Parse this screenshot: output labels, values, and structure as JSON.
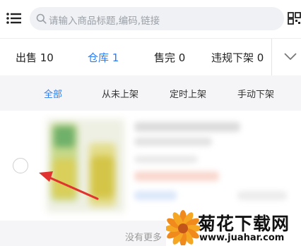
{
  "header": {
    "menu_icon": "menu-list-icon",
    "search_placeholder": "请输入商品标题,编码,链接",
    "search_icon": "search-icon",
    "scan_icon": "scan-icon"
  },
  "status_tabs": [
    {
      "label": "出售 10",
      "active": false
    },
    {
      "label": "仓库 1",
      "active": true
    },
    {
      "label": "售完 0",
      "active": false
    },
    {
      "label": "违规下架 0",
      "active": false
    }
  ],
  "expand_icon": "chevron-down-icon",
  "sub_tabs": [
    {
      "label": "全部",
      "active": true
    },
    {
      "label": "从未上架",
      "active": false
    },
    {
      "label": "定时上架",
      "active": false
    },
    {
      "label": "手动下架",
      "active": false
    }
  ],
  "product": {
    "select_state": "unchecked",
    "thumbnail": "product-thumbnail-blurred"
  },
  "footer": {
    "no_more": "没有更多"
  },
  "watermark": {
    "title": "菊花下载网",
    "url": "www.juahar.com"
  },
  "colors": {
    "accent": "#2b7cf4",
    "annotation_arrow": "#e0322f",
    "watermark_flower": "#f08a1c"
  }
}
